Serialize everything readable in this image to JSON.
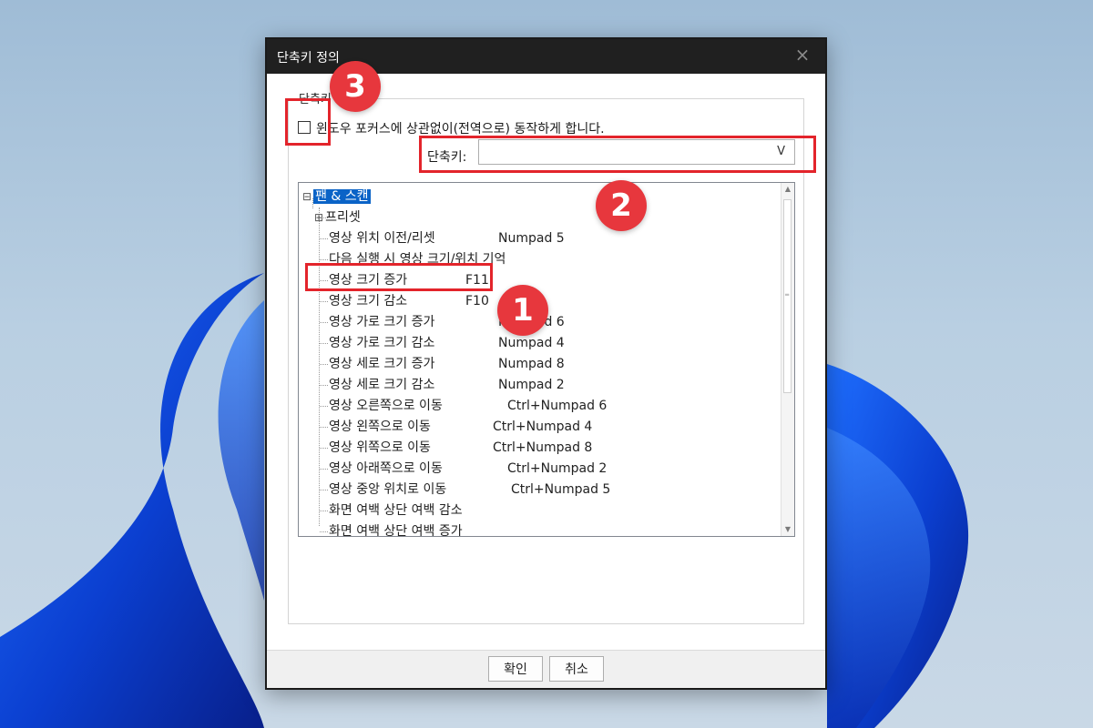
{
  "dialog": {
    "title": "단축키 정의",
    "close_icon": "×",
    "group_label": "단축키",
    "global_checkbox": {
      "label": "윈도우 포커스에 상관없이(전역으로) 동작하게 합니다.",
      "checked": false
    },
    "shortcut": {
      "label": "단축키:",
      "value": "",
      "arrow": "V"
    },
    "tree": {
      "root": {
        "label": "팬 & 스캔",
        "expander": "⊟"
      },
      "children": [
        {
          "label": "프리셋",
          "key": "",
          "expander": "⊞"
        },
        {
          "label": "영상 위치 이전/리셋",
          "key": "Numpad 5"
        },
        {
          "label": "다음 실행 시 영상 크기/위치 기억",
          "key": ""
        },
        {
          "label": "영상 크기 증가",
          "key": "F11"
        },
        {
          "label": "영상 크기 감소",
          "key": "F10"
        },
        {
          "label": "영상 가로 크기 증가",
          "key": "Numpad 6"
        },
        {
          "label": "영상 가로 크기 감소",
          "key": "Numpad 4"
        },
        {
          "label": "영상 세로 크기 증가",
          "key": "Numpad 8"
        },
        {
          "label": "영상 세로 크기 감소",
          "key": "Numpad 2"
        },
        {
          "label": "영상 오른쪽으로 이동",
          "key": "Ctrl+Numpad 6"
        },
        {
          "label": "영상 왼쪽으로 이동",
          "key": "Ctrl+Numpad 4"
        },
        {
          "label": "영상 위쪽으로 이동",
          "key": "Ctrl+Numpad 8"
        },
        {
          "label": "영상 아래쪽으로 이동",
          "key": "Ctrl+Numpad 2"
        },
        {
          "label": "영상 중앙 위치로 이동",
          "key": "Ctrl+Numpad 5"
        },
        {
          "label": "화면 여백 상단 여백 감소",
          "key": ""
        },
        {
          "label": "화면 여백 상단 여백 증가",
          "key": ""
        }
      ]
    },
    "buttons": {
      "ok": "확인",
      "cancel": "취소"
    }
  },
  "markers": [
    "1",
    "2",
    "3"
  ],
  "colors": {
    "titlebar": "#202020",
    "selection": "#0a63c7",
    "annotation": "#e3242b"
  }
}
